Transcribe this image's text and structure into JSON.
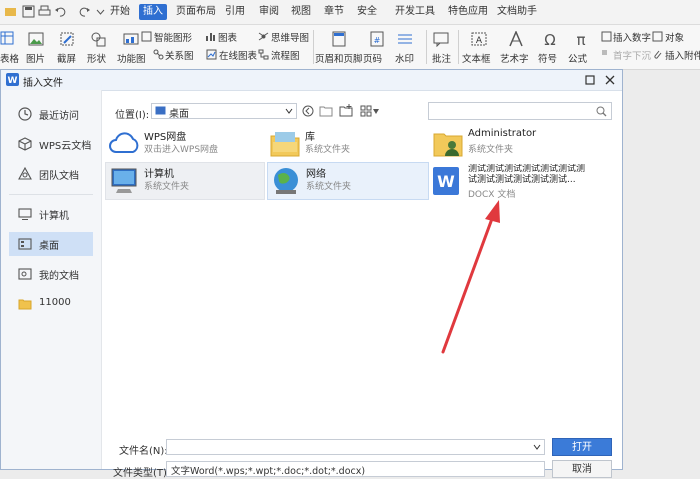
{
  "menubar": {
    "items": [
      "开始",
      "插入",
      "页面布局",
      "引用",
      "审阅",
      "视图",
      "章节",
      "安全",
      "开发工具",
      "特色应用",
      "文档助手"
    ],
    "active_index": 1,
    "accent": "#2f6fd1"
  },
  "toolbar": {
    "items": [
      {
        "label": "表格",
        "icon": "table-icon"
      },
      {
        "label": "图片",
        "icon": "picture-icon"
      },
      {
        "label": "截屏",
        "icon": "screenshot-icon"
      },
      {
        "label": "形状",
        "icon": "shapes-icon"
      },
      {
        "label": "功能图",
        "icon": "function-chart-icon"
      },
      {
        "label": "智能图形",
        "icon": "smartart-icon"
      },
      {
        "label": "图表",
        "icon": "chart-icon"
      },
      {
        "label": "关系图",
        "icon": "relation-icon"
      },
      {
        "label": "在线图表",
        "icon": "online-chart-icon"
      },
      {
        "label": "思维导图",
        "icon": "mindmap-icon"
      },
      {
        "label": "流程图",
        "icon": "flowchart-icon"
      },
      {
        "label": "页眉和页脚",
        "icon": "header-footer-icon"
      },
      {
        "label": "页码",
        "icon": "page-number-icon"
      },
      {
        "label": "水印",
        "icon": "watermark-icon"
      },
      {
        "label": "批注",
        "icon": "comment-icon"
      },
      {
        "label": "文本框",
        "icon": "textbox-icon"
      },
      {
        "label": "艺术字",
        "icon": "wordart-icon"
      },
      {
        "label": "符号",
        "icon": "symbol-icon"
      },
      {
        "label": "公式",
        "icon": "formula-icon"
      },
      {
        "label": "插入数字",
        "icon": "insert-number-icon"
      },
      {
        "label": "首字下沉",
        "icon": "drop-cap-icon"
      },
      {
        "label": "对象",
        "icon": "object-icon"
      },
      {
        "label": "插入附件",
        "icon": "attachment-icon"
      }
    ]
  },
  "dialog": {
    "title": "插入文件",
    "location_label": "位置(I):",
    "location_value": "桌面",
    "filename_label": "文件名(N):",
    "filetype_label": "文件类型(T):",
    "filetype_value": "文字Word(*.wps;*.wpt;*.doc;*.dot;*.docx)",
    "open_button": "打开",
    "cancel_button": "取消",
    "sidebar": [
      {
        "label": "最近访问",
        "icon": "clock-icon"
      },
      {
        "label": "WPS云文档",
        "icon": "cube-icon"
      },
      {
        "label": "团队文档",
        "icon": "team-icon"
      },
      {
        "label": "计算机",
        "icon": "monitor-icon"
      },
      {
        "label": "桌面",
        "icon": "desktop-icon"
      },
      {
        "label": "我的文档",
        "icon": "my-docs-icon"
      },
      {
        "label": "11000",
        "icon": "folder-icon"
      }
    ],
    "selected_sidebar": 4,
    "files": [
      {
        "name": "WPS网盘",
        "desc": "双击进入WPS网盘",
        "icon": "cloud-icon"
      },
      {
        "name": "库",
        "desc": "系统文件夹",
        "icon": "library-icon"
      },
      {
        "name": "Administrator",
        "desc": "系统文件夹",
        "icon": "user-folder-icon"
      },
      {
        "name": "计算机",
        "desc": "系统文件夹",
        "icon": "computer-icon"
      },
      {
        "name": "网络",
        "desc": "系统文件夹",
        "icon": "network-icon"
      },
      {
        "name": "测试测试测试测试测试测试测试测试测试测试测试测试...",
        "desc": "DOCX 文档",
        "icon": "wps-doc-icon"
      }
    ]
  },
  "annotation": {
    "color": "#e0393e",
    "icon": "red-arrow"
  }
}
